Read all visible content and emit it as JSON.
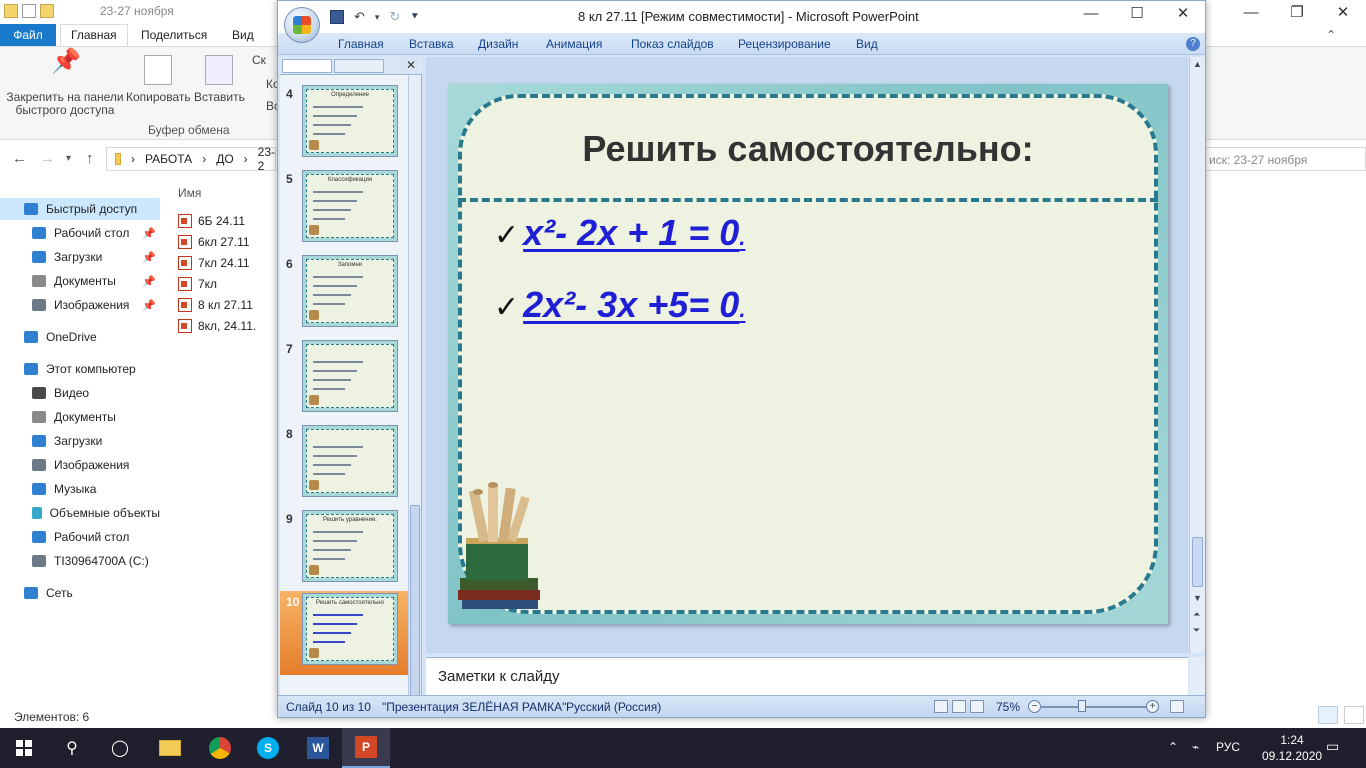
{
  "explorer": {
    "window_title": "23-27 ноября",
    "tabs": {
      "file": "Файл",
      "home": "Главная",
      "share": "Поделиться",
      "view": "Вид"
    },
    "ribbon": {
      "pin_label": "Закрепить на панели быстрого доступа",
      "copy_label": "Копировать",
      "paste_label": "Вставить",
      "small1": "Ск",
      "small2": "Ко",
      "small3": "Вс",
      "group_label": "Буфер обмена"
    },
    "address": {
      "seg1": "РАБОТА",
      "seg2": "ДО",
      "seg3": "23-2"
    },
    "search_placeholder": "иск: 23-27 ноября",
    "nav": [
      {
        "label": "Быстрый доступ",
        "color": "#2f80d1",
        "pin": false,
        "selected": true
      },
      {
        "label": "Рабочий стол",
        "color": "#2f80d1",
        "pin": true
      },
      {
        "label": "Загрузки",
        "color": "#2f80d1",
        "pin": true
      },
      {
        "label": "Документы",
        "color": "#8a8a8a",
        "pin": true
      },
      {
        "label": "Изображения",
        "color": "#6c7a88",
        "pin": true
      },
      {
        "label": "OneDrive",
        "color": "#2f80d1",
        "pin": false
      },
      {
        "label": "Этот компьютер",
        "color": "#2f80d1",
        "pin": false
      },
      {
        "label": "Видео",
        "color": "#4a4a4a",
        "pin": false
      },
      {
        "label": "Документы",
        "color": "#8a8a8a",
        "pin": false
      },
      {
        "label": "Загрузки",
        "color": "#2f80d1",
        "pin": false
      },
      {
        "label": "Изображения",
        "color": "#6c7a88",
        "pin": false
      },
      {
        "label": "Музыка",
        "color": "#2f80d1",
        "pin": false
      },
      {
        "label": "Объемные объекты",
        "color": "#35a8c8",
        "pin": false
      },
      {
        "label": "Рабочий стол",
        "color": "#2f80d1",
        "pin": false
      },
      {
        "label": "TI30964700A (C:)",
        "color": "#6c7a88",
        "pin": false
      },
      {
        "label": "Сеть",
        "color": "#2f80d1",
        "pin": false
      }
    ],
    "column_name": "Имя",
    "files": [
      "6Б 24.11",
      "6кл 27.11",
      "7кл 24.11",
      "7кл",
      "8 кл 27.11",
      "8кл, 24.11."
    ],
    "status": "Элементов: 6"
  },
  "powerpoint": {
    "title": "8 кл 27.11 [Режим совместимости] - Microsoft PowerPoint",
    "menu": [
      "Главная",
      "Вставка",
      "Дизайн",
      "Анимация",
      "Показ слайдов",
      "Рецензирование",
      "Вид"
    ],
    "thumbnails": [
      {
        "num": "4",
        "title": "Определение"
      },
      {
        "num": "5",
        "title": "Классификация"
      },
      {
        "num": "6",
        "title": "Запомни"
      },
      {
        "num": "7",
        "title": ""
      },
      {
        "num": "8",
        "title": ""
      },
      {
        "num": "9",
        "title": "Решить уравнение:"
      },
      {
        "num": "10",
        "title": "Решить самостоятельно",
        "selected": true
      }
    ],
    "slide": {
      "title": "Решить самостоятельно:",
      "eq1": "x²- 2x + 1 = 0",
      "eq2": "2x²- 3x +5= 0",
      "dot": "."
    },
    "notes_placeholder": "Заметки к слайду",
    "status": {
      "slide_counter": "Слайд 10 из 10",
      "theme": "\"Презентация ЗЕЛЁНАЯ РАМКА\"",
      "language": "Русский (Россия)",
      "zoom": "75%"
    }
  },
  "taskbar": {
    "lang": "РУС",
    "time": "1:24",
    "date": "09.12.2020"
  }
}
